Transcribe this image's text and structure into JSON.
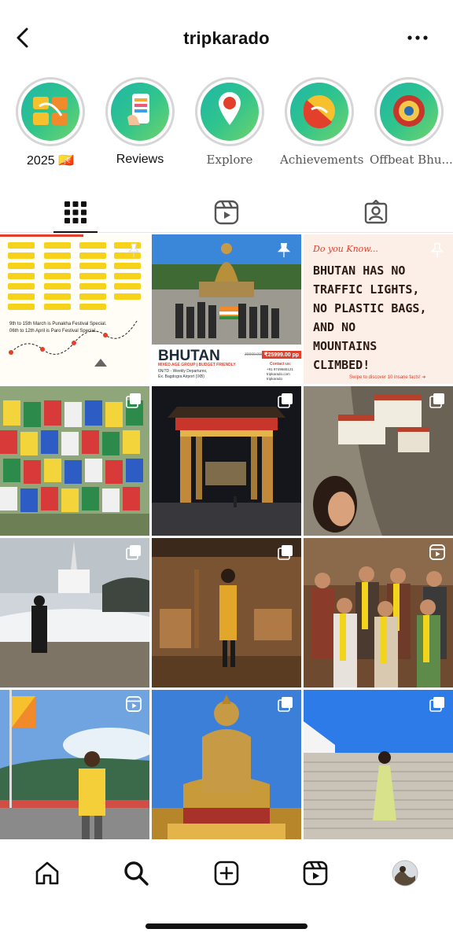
{
  "header": {
    "title": "tripkarado"
  },
  "highlights": [
    {
      "label": "2025 🇧🇹"
    },
    {
      "label": "Reviews"
    },
    {
      "label": "Explore"
    },
    {
      "label": "Achievements"
    },
    {
      "label": "Offbeat Bhu..."
    }
  ],
  "posts": {
    "p1": {
      "line1": "9th to 15th March is Punakha Festival Special.",
      "line2": "06th to 12th April is Paro Festival Special."
    },
    "p2": {
      "headline": "BHUTAN",
      "sub1": "MIXED AGE GROUP | BUDGET FRIENDLY",
      "sub2": "6N/7D - Weekly Departures,",
      "sub3": "Ex. Bagdogra Airport (IXB)",
      "price_old": "39999.00/-",
      "price_new": "₹25999.00 pp",
      "contact_title": "Contact us:",
      "contact1": "+91 9749665121",
      "contact2": "tripkarado.com",
      "contact3": "tripkarado"
    },
    "p3": {
      "kicker": "Do you Know...",
      "l1": "BHUTAN HAS NO",
      "l2": "TRAFFIC LIGHTS,",
      "l3": "NO PLASTIC BAGS,",
      "l4": "AND NO",
      "l5": "MOUNTAINS",
      "l6": "CLIMBED!",
      "footer": "Swipe to discover 10 insane facts! ➔"
    }
  },
  "colors": {
    "accent_red": "#e2402a",
    "ring_green": "#30c48d",
    "fact_bg": "#fbefe8"
  }
}
